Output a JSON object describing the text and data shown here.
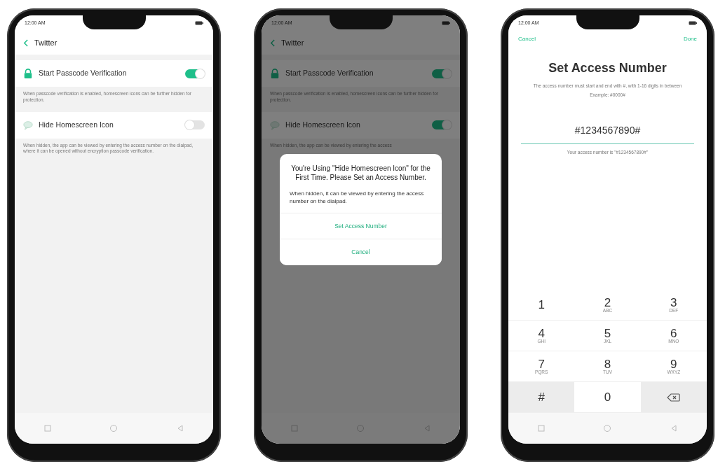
{
  "phones": [
    {
      "kind": "settings",
      "dimmed": false,
      "status": {
        "time": "12:00 AM"
      },
      "title": "Twitter",
      "items": [
        {
          "kind": "lock",
          "label": "Start Passcode Verification",
          "on": true,
          "description": "When passcode verification is enabled, homescreen icons can be further hidden for protection."
        },
        {
          "kind": "chat",
          "label": "Hide Homescreen Icon",
          "on": false,
          "description": "When hidden, the app can be viewed by entering the access number on the dialpad, where it can be opened without encryption passcode verification."
        }
      ]
    },
    {
      "kind": "settings",
      "dimmed": true,
      "status": {
        "time": "12:00 AM"
      },
      "title": "Twitter",
      "items": [
        {
          "kind": "lock",
          "label": "Start Passcode Verification",
          "on": true,
          "description": "When passcode verification is enabled, homescreen icons can be further hidden for protection."
        },
        {
          "kind": "chat",
          "label": "Hide Homescreen Icon",
          "on": true,
          "description": "When hidden, the app can be viewed by entering the access"
        }
      ],
      "dialog": {
        "title": "You're Using \"Hide Homescreen Icon\" for the First Time. Please Set an Access Number.",
        "message": "When hidden, it can be viewed by entering the access number on the dialpad.",
        "actions": [
          "Set Access Number",
          "Cancel"
        ]
      }
    },
    {
      "kind": "keypad",
      "dimmed": false,
      "status": {
        "time": "12:00 AM"
      },
      "cancel": "Cancel",
      "done": "Done",
      "title": "Set Access Number",
      "hint": "The access number must start and end with #, with 1-16 digits in between",
      "example": "Example: #0000#",
      "value": "#1234567890#",
      "confirmation": "Your access number is \"#1234567890#\"",
      "keys": [
        {
          "kind": "digit",
          "digit": "1"
        },
        {
          "kind": "digit",
          "digit": "2",
          "letters": "ABC"
        },
        {
          "kind": "digit",
          "digit": "3",
          "letters": "DEF"
        },
        {
          "kind": "digit",
          "digit": "4",
          "letters": "GHI"
        },
        {
          "kind": "digit",
          "digit": "5",
          "letters": "JKL"
        },
        {
          "kind": "digit",
          "digit": "6",
          "letters": "MNO"
        },
        {
          "kind": "digit",
          "digit": "7",
          "letters": "PQRS"
        },
        {
          "kind": "digit",
          "digit": "8",
          "letters": "TUV"
        },
        {
          "kind": "digit",
          "digit": "9",
          "letters": "WXYZ"
        },
        {
          "kind": "symbol",
          "digit": "#"
        },
        {
          "kind": "digit",
          "digit": "0"
        },
        {
          "kind": "delete"
        }
      ]
    }
  ]
}
